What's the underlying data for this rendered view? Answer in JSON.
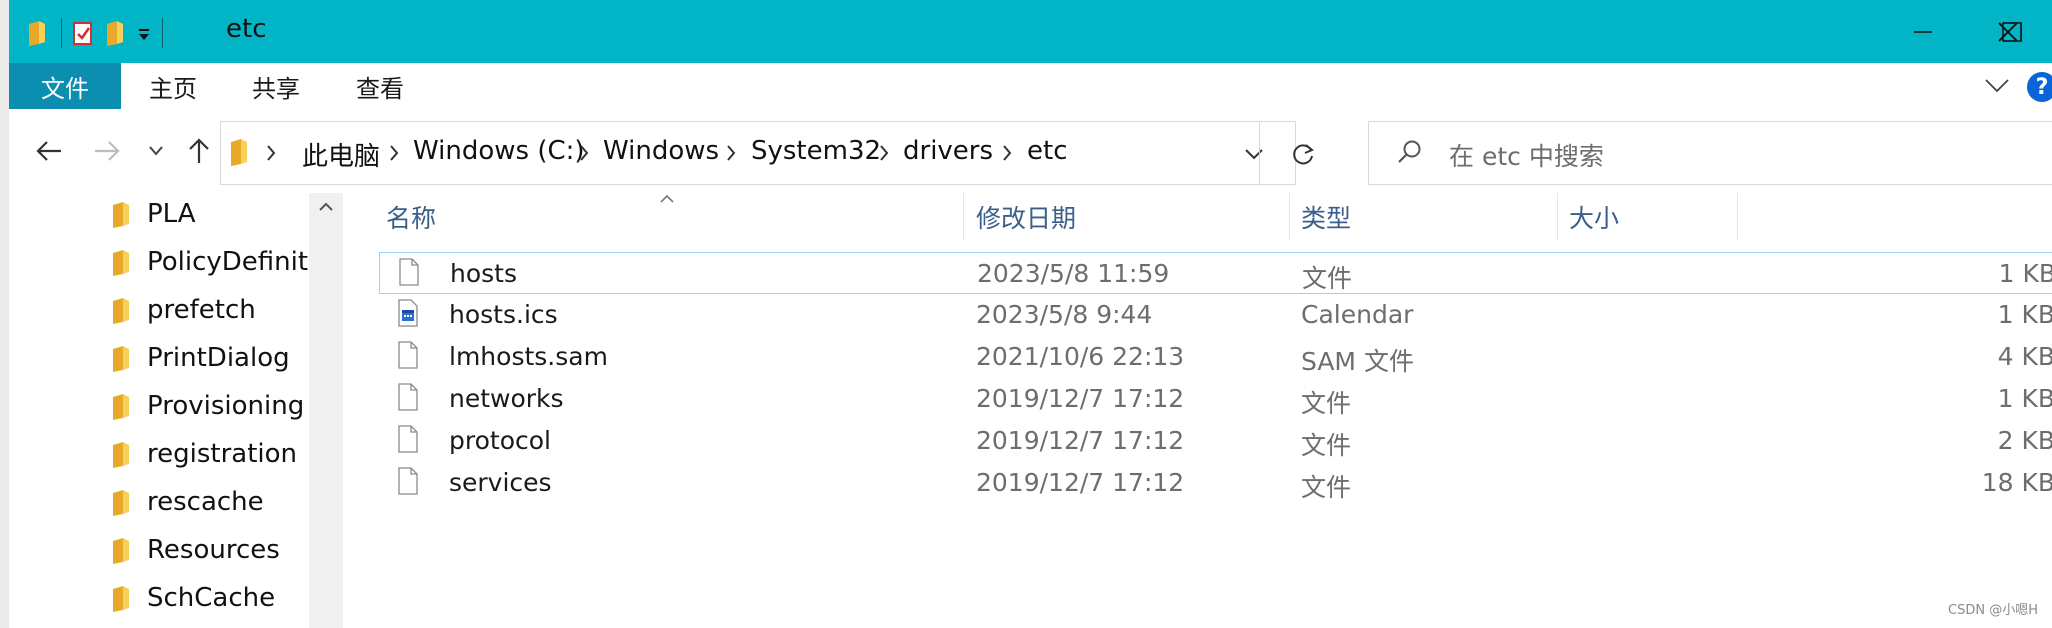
{
  "window": {
    "title": "etc",
    "accent": "#01b4c6"
  },
  "ribbon": {
    "tabs": [
      "文件",
      "主页",
      "共享",
      "查看"
    ],
    "help_label": "?"
  },
  "address": {
    "crumbs": [
      "此电脑",
      "Windows (C:)",
      "Windows",
      "System32",
      "drivers",
      "etc"
    ],
    "refresh_icon": "refresh-icon"
  },
  "search": {
    "placeholder": "在 etc 中搜索"
  },
  "nav_pane": {
    "items": [
      "PLA",
      "PolicyDefinitions",
      "prefetch",
      "PrintDialog",
      "Provisioning",
      "registration",
      "rescache",
      "Resources",
      "SchCache"
    ]
  },
  "columns": [
    "名称",
    "修改日期",
    "类型",
    "大小"
  ],
  "files": [
    {
      "name": "hosts",
      "date": "2023/5/8 11:59",
      "type": "文件",
      "size": "1 KB",
      "icon": "file-icon"
    },
    {
      "name": "hosts.ics",
      "date": "2023/5/8 9:44",
      "type": "Calendar",
      "size": "1 KB",
      "icon": "calendar-file-icon"
    },
    {
      "name": "lmhosts.sam",
      "date": "2021/10/6 22:13",
      "type": "SAM 文件",
      "size": "4 KB",
      "icon": "file-icon"
    },
    {
      "name": "networks",
      "date": "2019/12/7 17:12",
      "type": "文件",
      "size": "1 KB",
      "icon": "file-icon"
    },
    {
      "name": "protocol",
      "date": "2019/12/7 17:12",
      "type": "文件",
      "size": "2 KB",
      "icon": "file-icon"
    },
    {
      "name": "services",
      "date": "2019/12/7 17:12",
      "type": "文件",
      "size": "18 KB",
      "icon": "file-icon"
    }
  ],
  "watermark": "CSDN @小嗯H"
}
